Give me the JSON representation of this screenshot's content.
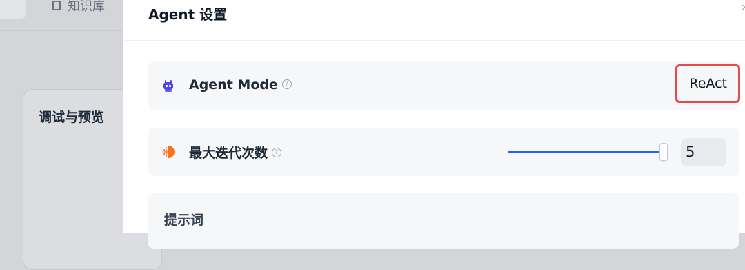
{
  "background": {
    "knowledge_base_label": "知识库",
    "debug_preview_title": "调试与预览"
  },
  "drawer": {
    "title": "Agent 设置",
    "agent_mode": {
      "label": "Agent Mode",
      "value": "ReAct",
      "icon": "robot-icon",
      "highlight_color": "#e5484d"
    },
    "max_iterations": {
      "label": "最大迭代次数",
      "value": "5",
      "slider_fraction": 1.0,
      "icon": "iteration-icon",
      "accent_color": "#2563eb"
    },
    "prompt": {
      "label": "提示词"
    }
  }
}
